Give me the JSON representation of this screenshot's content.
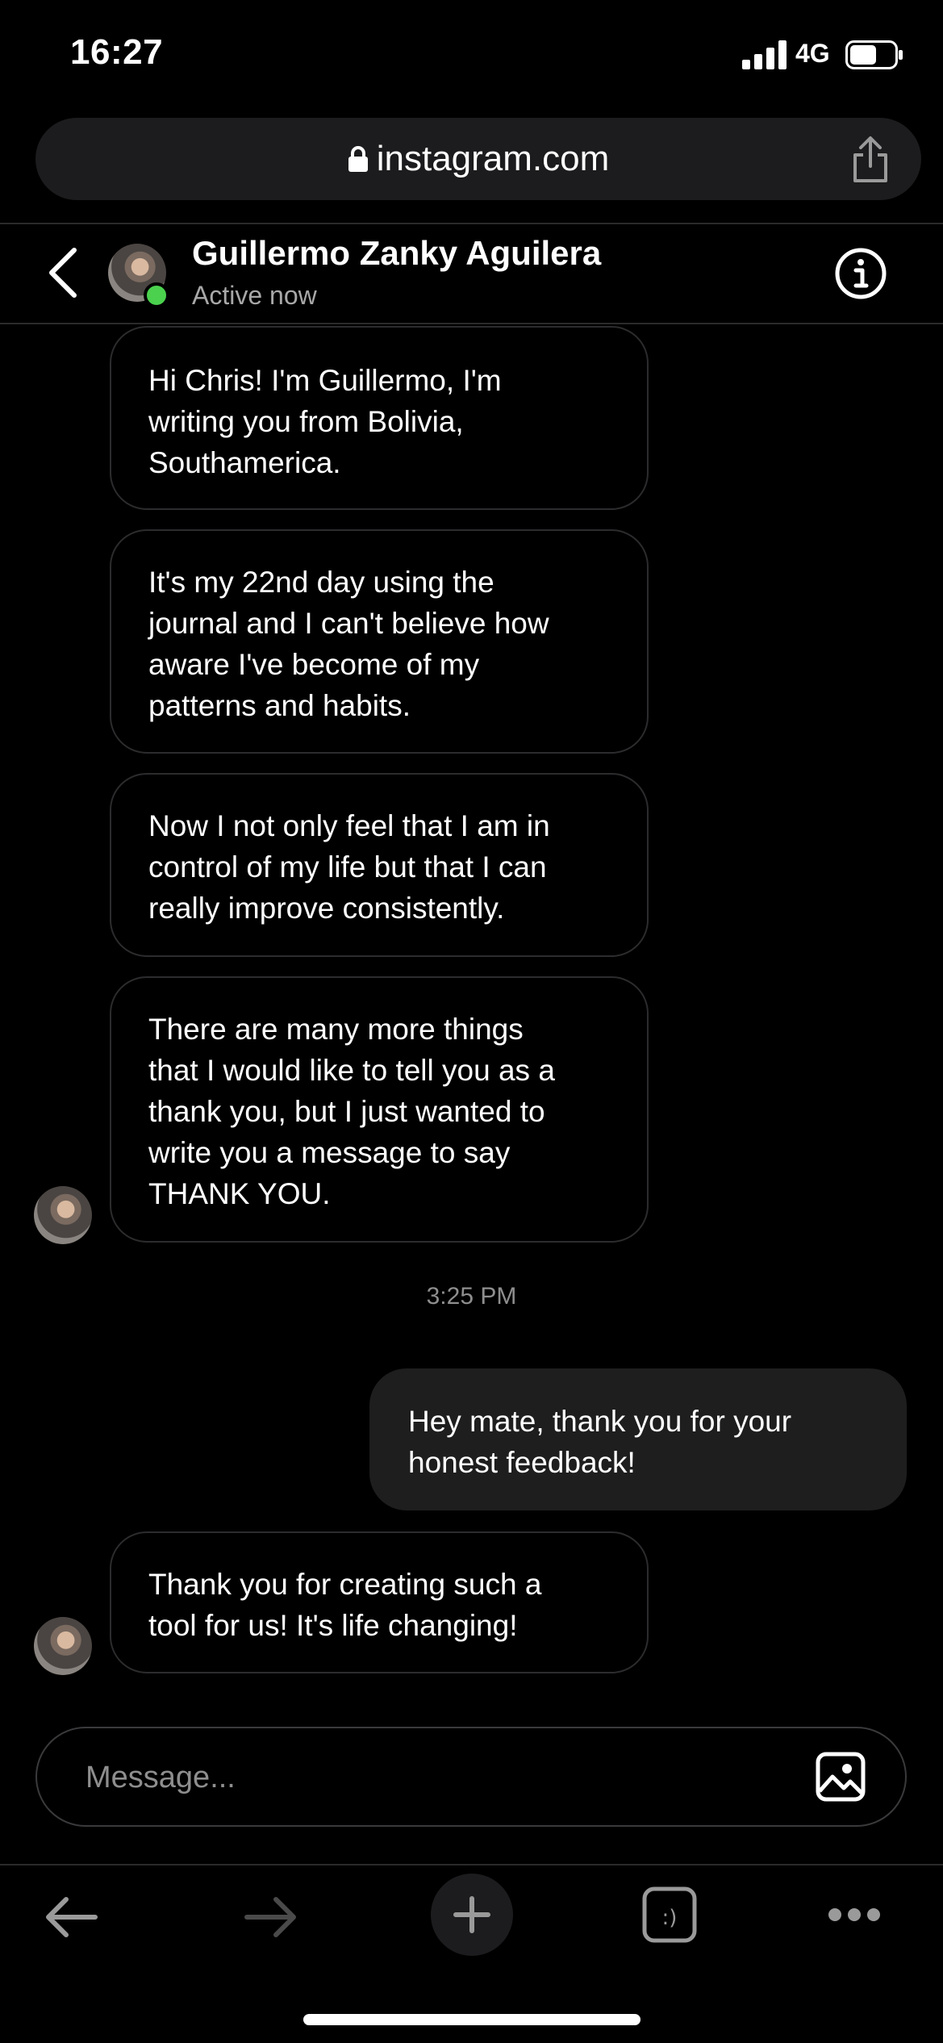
{
  "status_bar": {
    "time": "16:27",
    "network": "4G"
  },
  "browser": {
    "url": "instagram.com"
  },
  "header": {
    "name": "Guillermo Zanky Aguilera",
    "status": "Active now"
  },
  "messages": [
    {
      "from": "them",
      "text": "Hi Chris! I'm Guillermo, I'm\nwriting you from Bolivia,\nSouthamerica."
    },
    {
      "from": "them",
      "text": "It's my 22nd day using the\njournal and I can't believe how\naware I've become of my\npatterns and habits."
    },
    {
      "from": "them",
      "text": "Now I not only feel that I am in\ncontrol of my life but that I can\nreally improve consistently."
    },
    {
      "from": "them",
      "text": "There are many more things\nthat I would like to tell you as a\nthank you, but I just wanted to\nwrite you a message to say\nTHANK YOU."
    },
    {
      "from": "me",
      "text": "Hey mate, thank you for your\nhonest feedback!"
    },
    {
      "from": "them",
      "text": "Thank you for creating such a\ntool for us! It's life changing!"
    }
  ],
  "timestamp": "3:25 PM",
  "composer": {
    "placeholder": "Message..."
  },
  "colors": {
    "online": "#4bd14e",
    "bubble_out": "#1e1e1e",
    "background": "#000000"
  },
  "icons": [
    "signal-icon",
    "battery-icon",
    "lock-icon",
    "share-icon",
    "back-chevron-icon",
    "info-icon",
    "gallery-icon",
    "back-arrow-icon",
    "forward-arrow-icon",
    "new-tab-plus-icon",
    "tabs-icon",
    "more-icon"
  ]
}
